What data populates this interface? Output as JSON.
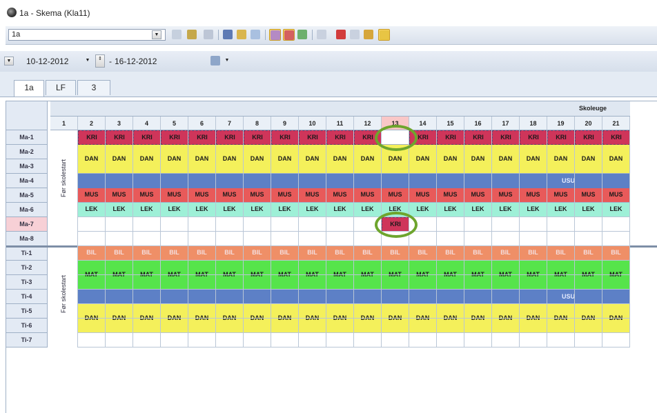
{
  "window": {
    "title": "1a -  Skema  (Kla11)"
  },
  "toolbar": {
    "class_value": "1a"
  },
  "dates": {
    "from": "10-12-2012",
    "to": "16-12-2012"
  },
  "tabs": [
    "1a",
    "LF",
    "3"
  ],
  "grid": {
    "week_label": "Skoleuge",
    "weeks": [
      "1",
      "2",
      "3",
      "4",
      "5",
      "6",
      "7",
      "8",
      "9",
      "10",
      "11",
      "12",
      "13",
      "14",
      "15",
      "16",
      "17",
      "18",
      "19",
      "20",
      "21"
    ],
    "highlight_week": "13",
    "rows": [
      "Ma-1",
      "Ma-2",
      "Ma-3",
      "Ma-4",
      "Ma-5",
      "Ma-6",
      "Ma-7",
      "Ma-8",
      "Ti-1",
      "Ti-2",
      "Ti-3",
      "Ti-4",
      "Ti-5",
      "Ti-6",
      "Ti-7"
    ],
    "highlight_row": "Ma-7",
    "pre_school_label": "Før skolestart",
    "bands": {
      "mon": [
        {
          "label": "KRI",
          "color": "#cf355a"
        },
        {
          "label": "DAN",
          "color": "#f4f05b"
        },
        {
          "label": "USU",
          "color": "#5d80c6"
        },
        {
          "label": "MUS",
          "color": "#e85a5a"
        },
        {
          "label": "LEK",
          "color": "#9ef0d7"
        }
      ],
      "tue": [
        {
          "label": "BIL",
          "color": "#ef8f67"
        },
        {
          "label": "MAT",
          "color": "#56e44b"
        },
        {
          "label": "USU",
          "color": "#5d80c6"
        },
        {
          "label": "DAN",
          "color": "#f4f05b"
        }
      ]
    },
    "moved_label": "KRI",
    "ring_color": "#6ea52d"
  }
}
